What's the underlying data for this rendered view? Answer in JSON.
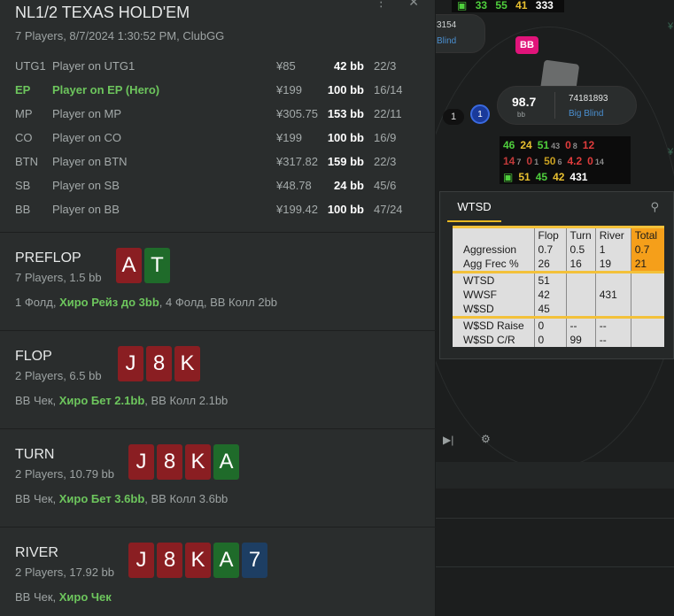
{
  "hand": {
    "title": "NL1/2 TEXAS HOLD'EM",
    "subtitle": "7 Players, 8/7/2024 1:30:52 PM, ClubGG",
    "top_icons": "⋮ ✕",
    "players": [
      {
        "pos": "UTG1",
        "name": "Player on UTG1",
        "money": "¥85",
        "bb": "42 bb",
        "ratio": "22/3",
        "hero": false
      },
      {
        "pos": "EP",
        "name": "Player on EP (Hero)",
        "money": "¥199",
        "bb": "100 bb",
        "ratio": "16/14",
        "hero": true
      },
      {
        "pos": "MP",
        "name": "Player on MP",
        "money": "¥305.75",
        "bb": "153 bb",
        "ratio": "22/11",
        "hero": false
      },
      {
        "pos": "CO",
        "name": "Player on CO",
        "money": "¥199",
        "bb": "100 bb",
        "ratio": "16/9",
        "hero": false
      },
      {
        "pos": "BTN",
        "name": "Player on BTN",
        "money": "¥317.82",
        "bb": "159 bb",
        "ratio": "22/3",
        "hero": false
      },
      {
        "pos": "SB",
        "name": "Player on SB",
        "money": "¥48.78",
        "bb": "24 bb",
        "ratio": "45/6",
        "hero": false
      },
      {
        "pos": "BB",
        "name": "Player on BB",
        "money": "¥199.42",
        "bb": "100 bb",
        "ratio": "47/24",
        "hero": false
      }
    ],
    "streets": [
      {
        "name": "PREFLOP",
        "sub": "7 Players, 1.5 bb",
        "cards": [
          {
            "r": "A",
            "c": "red"
          },
          {
            "r": "T",
            "c": "green"
          }
        ],
        "actions": [
          {
            "t": "1 Фолд, ",
            "h": false
          },
          {
            "t": "Хиро Рейз до 3bb",
            "h": true
          },
          {
            "t": ", 4 Фолд, BB Колл 2bb",
            "h": false
          }
        ]
      },
      {
        "name": "FLOP",
        "sub": "2 Players, 6.5 bb",
        "cards": [
          {
            "r": "J",
            "c": "red"
          },
          {
            "r": "8",
            "c": "red"
          },
          {
            "r": "K",
            "c": "red"
          }
        ],
        "actions": [
          {
            "t": "BB Чек, ",
            "h": false
          },
          {
            "t": "Хиро Бет 2.1bb",
            "h": true
          },
          {
            "t": ", BB Колл 2.1bb",
            "h": false
          }
        ]
      },
      {
        "name": "TURN",
        "sub": "2 Players, 10.79 bb",
        "cards": [
          {
            "r": "J",
            "c": "red"
          },
          {
            "r": "8",
            "c": "red"
          },
          {
            "r": "K",
            "c": "red"
          },
          {
            "r": "A",
            "c": "green"
          }
        ],
        "actions": [
          {
            "t": "BB Чек, ",
            "h": false
          },
          {
            "t": "Хиро Бет 3.6bb",
            "h": true
          },
          {
            "t": ", BB Колл 3.6bb",
            "h": false
          }
        ]
      },
      {
        "name": "RIVER",
        "sub": "2 Players, 17.92 bb",
        "cards": [
          {
            "r": "J",
            "c": "red"
          },
          {
            "r": "8",
            "c": "red"
          },
          {
            "r": "K",
            "c": "red"
          },
          {
            "r": "A",
            "c": "green"
          },
          {
            "r": "7",
            "c": "blue"
          }
        ],
        "actions": [
          {
            "t": "BB Чек, ",
            "h": false
          },
          {
            "t": "Хиро Чек",
            "h": true
          }
        ]
      }
    ]
  },
  "table": {
    "top_hud": [
      "33",
      "55",
      "41",
      "333"
    ],
    "seat_left": {
      "id": "3154",
      "label": "Blind"
    },
    "bb_badge": "BB",
    "seat_bb": {
      "stack": "98.7",
      "unit": "bb",
      "id": "74181893",
      "label": "Big Blind"
    },
    "dealer_count": "1",
    "dealer_num": "1",
    "bb_hud": {
      "row1": [
        {
          "v": "46",
          "c": "#4fcf3d"
        },
        {
          "v": "24",
          "c": "#e8c030"
        },
        {
          "v": "51",
          "c": "#4fcf3d"
        },
        {
          "v": "43",
          "c": "#8a8a8a",
          "s": true
        },
        {
          "v": "0",
          "c": "#e03c3c"
        },
        {
          "v": "8",
          "c": "#8a8a8a",
          "s": true
        },
        {
          "v": "12",
          "c": "#e03c3c"
        }
      ],
      "row2": [
        {
          "v": "14",
          "c": "#c23a3a"
        },
        {
          "v": "7",
          "c": "#8a8a8a",
          "s": true
        },
        {
          "v": "0",
          "c": "#c23a3a"
        },
        {
          "v": "1",
          "c": "#8a8a8a",
          "s": true
        },
        {
          "v": "50",
          "c": "#c9a020"
        },
        {
          "v": "6",
          "c": "#8a8a8a",
          "s": true
        },
        {
          "v": "4.2",
          "c": "#e03c3c"
        },
        {
          "v": "0",
          "c": "#e03c3c"
        },
        {
          "v": "14",
          "c": "#8a8a8a",
          "s": true
        }
      ],
      "row3": [
        {
          "v": "51",
          "c": "#e8c030"
        },
        {
          "v": "45",
          "c": "#4fcf3d"
        },
        {
          "v": "42",
          "c": "#e8c030"
        },
        {
          "v": "431",
          "c": "#ffffff"
        }
      ]
    },
    "right_yen": "¥"
  },
  "wtsd": {
    "tab": "WTSD",
    "headers": [
      "",
      "Flop",
      "Turn",
      "River",
      "Total"
    ],
    "rows": [
      [
        "Aggression",
        "0.7",
        "0.5",
        "1",
        "0.7"
      ],
      [
        "Agg Frec %",
        "26",
        "16",
        "19",
        "21"
      ],
      [
        "WTSD",
        "51",
        "",
        "",
        ""
      ],
      [
        "WWSF",
        "42",
        "",
        "431",
        ""
      ],
      [
        "W$SD",
        "45",
        "",
        "",
        ""
      ],
      [
        "W$SD Raise",
        "0",
        "--",
        "--",
        ""
      ],
      [
        "W$SD C/R",
        "0",
        "99",
        "--",
        ""
      ]
    ]
  }
}
